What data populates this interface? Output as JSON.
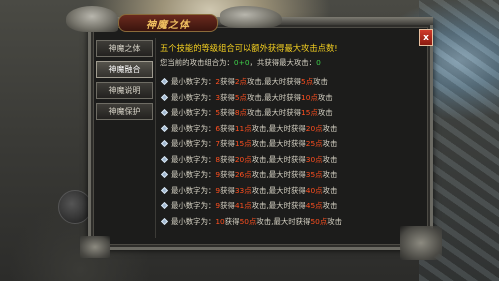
{
  "dialog": {
    "title": "神魔之体",
    "close_label": "x"
  },
  "tabs": [
    {
      "label": "神魔之体",
      "active": false
    },
    {
      "label": "神魔融合",
      "active": true
    },
    {
      "label": "神魔说明",
      "active": false
    },
    {
      "label": "神魔保护",
      "active": false
    }
  ],
  "content": {
    "heading": "五个技能的等级组合可以额外获得最大攻击点数!",
    "current_prefix": "您当前的攻击组合为：",
    "current_value": "0+0",
    "current_mid": "，共获得最大攻击：",
    "current_attack": "0"
  },
  "levels": [
    {
      "pre": "最小数字为：",
      "min": "2",
      "mid1": "获得",
      "gain": "2点",
      "mid2": "攻击,最大时获得",
      "max": "5点",
      "post": "攻击"
    },
    {
      "pre": "最小数字为：",
      "min": "3",
      "mid1": "获得",
      "gain": "5点",
      "mid2": "攻击,最大时获得",
      "max": "10点",
      "post": "攻击"
    },
    {
      "pre": "最小数字为：",
      "min": "5",
      "mid1": "获得",
      "gain": "8点",
      "mid2": "攻击,最大时获得",
      "max": "15点",
      "post": "攻击"
    },
    {
      "pre": "最小数字为：",
      "min": "6",
      "mid1": "获得",
      "gain": "11点",
      "mid2": "攻击,最大时获得",
      "max": "20点",
      "post": "攻击"
    },
    {
      "pre": "最小数字为：",
      "min": "7",
      "mid1": "获得",
      "gain": "15点",
      "mid2": "攻击,最大时获得",
      "max": "25点",
      "post": "攻击"
    },
    {
      "pre": "最小数字为：",
      "min": "8",
      "mid1": "获得",
      "gain": "20点",
      "mid2": "攻击,最大时获得",
      "max": "30点",
      "post": "攻击"
    },
    {
      "pre": "最小数字为：",
      "min": "9",
      "mid1": "获得",
      "gain": "26点",
      "mid2": "攻击,最大时获得",
      "max": "35点",
      "post": "攻击"
    },
    {
      "pre": "最小数字为：",
      "min": "9",
      "mid1": "获得",
      "gain": "33点",
      "mid2": "攻击,最大时获得",
      "max": "40点",
      "post": "攻击"
    },
    {
      "pre": "最小数字为：",
      "min": "9",
      "mid1": "获得",
      "gain": "41点",
      "mid2": "攻击,最大时获得",
      "max": "45点",
      "post": "攻击"
    },
    {
      "pre": "最小数字为：",
      "min": "10",
      "mid1": "获得",
      "gain": "50点",
      "mid2": "攻击,最大时获得",
      "max": "50点",
      "post": "攻击"
    }
  ],
  "colors": {
    "heading": "#f5d020",
    "highlight": "#ff4f1f",
    "green": "#3ed04a"
  }
}
